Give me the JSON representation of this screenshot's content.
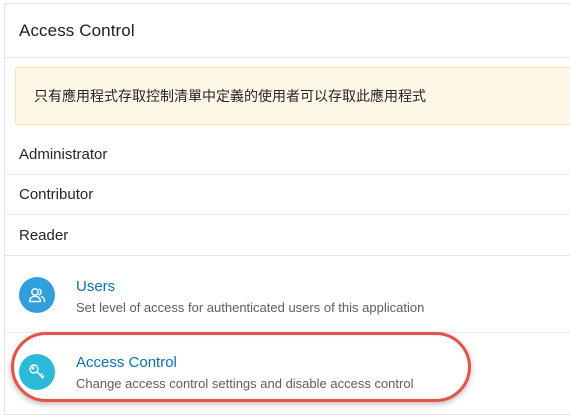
{
  "panel": {
    "title": "Access Control"
  },
  "notice": {
    "text": "只有應用程式存取控制清單中定義的使用者可以存取此應用程式"
  },
  "roles": [
    {
      "label": "Administrator"
    },
    {
      "label": "Contributor"
    },
    {
      "label": "Reader"
    }
  ],
  "links": [
    {
      "title": "Users",
      "description": "Set level of access for authenticated users of this application",
      "icon": "users-icon",
      "icon_color": "#309fdb"
    },
    {
      "title": "Access Control",
      "description": "Change access control settings and disable access control",
      "icon": "key-icon",
      "icon_color": "#2bbbd8"
    }
  ],
  "colors": {
    "link": "#0b6fb5",
    "notice_bg": "#fef7e6",
    "highlight": "#e5524a"
  }
}
